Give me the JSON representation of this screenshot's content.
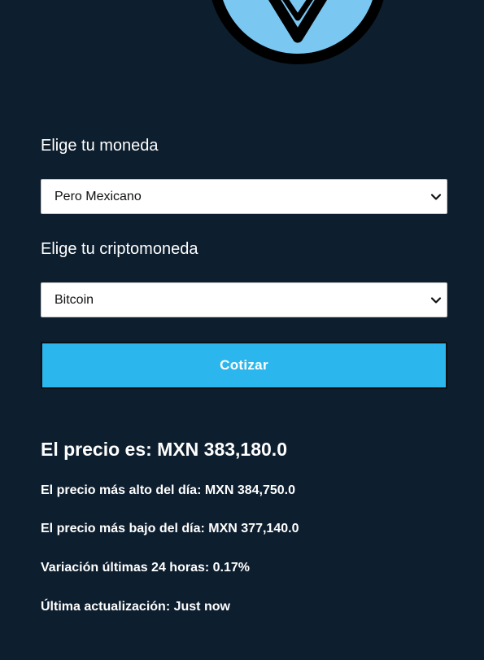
{
  "form": {
    "currency_label": "Elige tu moneda",
    "currency_selected": "Pero Mexicano",
    "crypto_label": "Elige tu criptomoneda",
    "crypto_selected": "Bitcoin",
    "submit_label": "Cotizar"
  },
  "result": {
    "price": "El precio es: MXN 383,180.0",
    "high": "El precio más alto del día: MXN 384,750.0",
    "low": "El precio más bajo del día: MXN 377,140.0",
    "change": "Variación últimas 24 horas: 0.17%",
    "updated": "Última actualización: Just now"
  },
  "colors": {
    "background": "#0d1e2e",
    "button": "#2cb6ee",
    "logo": "#7ac7f2"
  },
  "icons": {
    "logo": "crypto-logo-icon",
    "dropdown": "chevron-down-icon"
  }
}
